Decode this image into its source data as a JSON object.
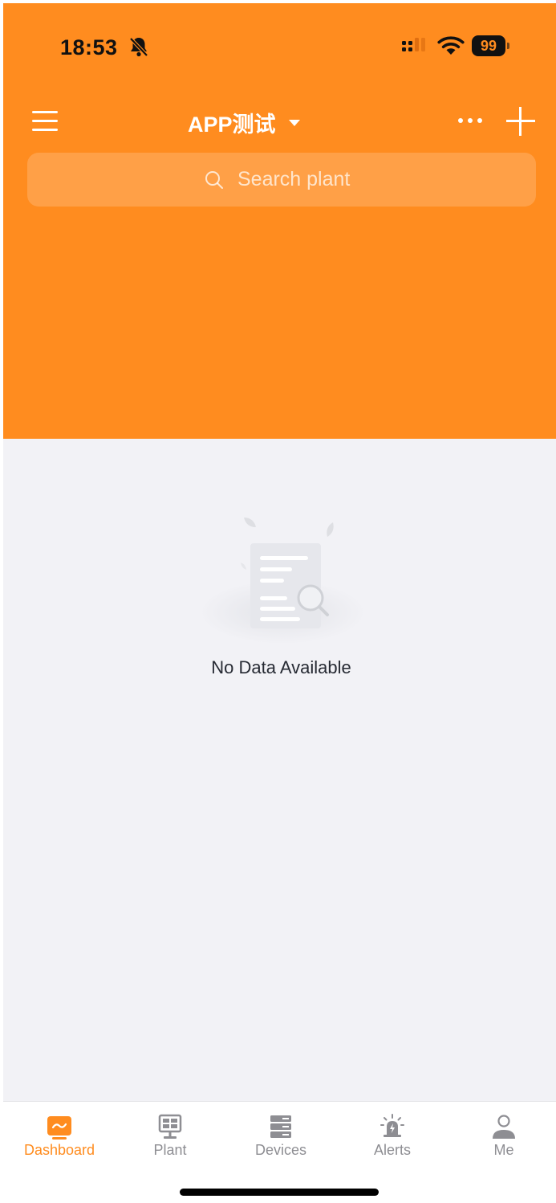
{
  "status_bar": {
    "time": "18:53",
    "battery": "99",
    "icons": [
      "bell-slash-icon",
      "cellular-signal-icon",
      "wifi-icon",
      "battery-icon"
    ]
  },
  "header": {
    "title": "APP测试",
    "menu_icon": "hamburger-menu-icon",
    "dropdown_icon": "caret-down-icon",
    "more_icon": "more-horizontal-icon",
    "add_icon": "plus-icon",
    "background_color": "#ff8c1f"
  },
  "search": {
    "placeholder": "Search plant",
    "icon": "search-icon"
  },
  "empty_state": {
    "message": "No Data Available",
    "icon": "empty-document-search-icon"
  },
  "tabbar": {
    "active_color": "#ff8c1f",
    "inactive_color": "#8e8e93",
    "items": [
      {
        "label": "Dashboard",
        "icon": "dashboard-icon",
        "active": true
      },
      {
        "label": "Plant",
        "icon": "solar-panel-icon",
        "active": false
      },
      {
        "label": "Devices",
        "icon": "server-stack-icon",
        "active": false
      },
      {
        "label": "Alerts",
        "icon": "alarm-light-icon",
        "active": false
      },
      {
        "label": "Me",
        "icon": "user-icon",
        "active": false
      }
    ]
  }
}
